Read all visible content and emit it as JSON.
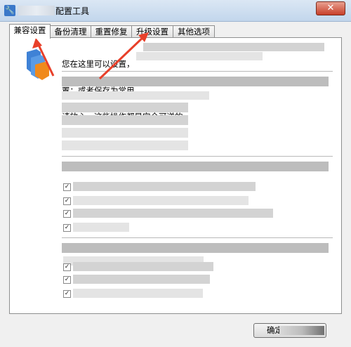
{
  "window": {
    "title": "配置工具"
  },
  "tabs": [
    {
      "label": "兼容设置",
      "active": true
    },
    {
      "label": "备份清理",
      "active": false
    },
    {
      "label": "重置修复",
      "active": false
    },
    {
      "label": "升级设置",
      "active": false
    },
    {
      "label": "其他选项",
      "active": false
    }
  ],
  "intro": {
    "line1": "您在这里可以设置，",
    "line2": "置；或者保存为常用",
    "line3": "请放心，这些操作都是完全可逆的。"
  },
  "checkboxes": {
    "checked_glyph": "✓"
  },
  "footer": {
    "ok_label": "确定"
  },
  "annotations": {
    "arrow_color": "#e8402a"
  },
  "colors": {
    "accent": "#3a78c9",
    "close": "#c8402a"
  }
}
